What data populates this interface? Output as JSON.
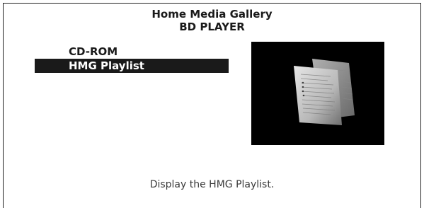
{
  "header": {
    "title": "Home Media Gallery",
    "subtitle": "BD PLAYER"
  },
  "menu": {
    "items": [
      {
        "label": "CD-ROM",
        "selected": false
      },
      {
        "label": "HMG Playlist",
        "selected": true
      }
    ]
  },
  "preview": {
    "icon": "document-pages-thumbnail"
  },
  "status": {
    "text": "Display the HMG Playlist."
  },
  "colors": {
    "highlight_bg": "#1a1a1a",
    "highlight_text": "#ffffff",
    "text": "#1a1a1a",
    "preview_bg": "#000000"
  }
}
